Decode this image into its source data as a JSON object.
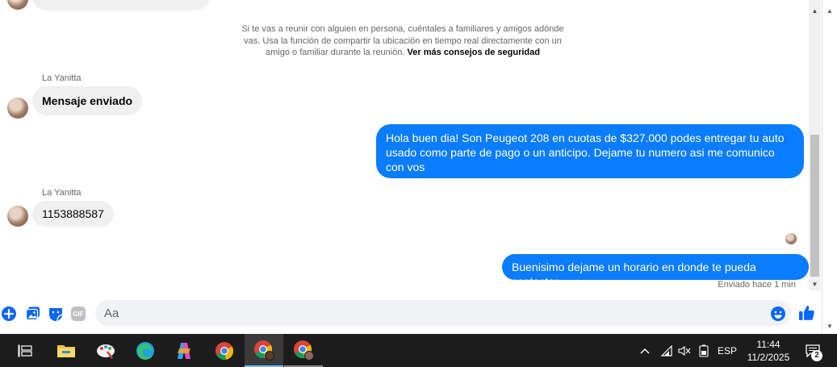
{
  "chat": {
    "safety_notice": {
      "text": "Si te vas a reunir con alguien en persona, cuéntales a familiares y amigos adónde vas. Usa la función de compartir la ubicación en tiempo real directamente con un amigo o familiar durante la reunión.",
      "link": "Ver más consejos de seguridad"
    },
    "messages": [
      {
        "sender": "La Yanitta",
        "text": "Mensaje enviado"
      },
      {
        "text": "Hola buen dia! Son Peugeot 208 en cuotas de $327.000 podes entregar tu auto usado como parte de pago o un anticipo. Dejame tu numero asi me comunico con vos"
      },
      {
        "sender": "La Yanitta",
        "text": "1153888587"
      },
      {
        "text": "Buenisimo dejame un horario en donde te pueda contactar"
      }
    ],
    "status": "Enviado hace 1 min"
  },
  "composer": {
    "placeholder": "Aa",
    "icons": [
      "plus-icon",
      "photo-icon",
      "sticker-icon",
      "gif-icon",
      "emoji-icon",
      "like-icon"
    ],
    "gif_label": "GIF"
  },
  "taskbar": {
    "apps": [
      "task-view",
      "file-explorer",
      "paint",
      "edge",
      "copilot",
      "chrome",
      "chrome-profile-1",
      "chrome-profile-2"
    ],
    "language": "ESP",
    "time": "11:44",
    "date": "11/2/2025",
    "notification_count": "2"
  },
  "colors": {
    "outgoing_bubble": "#0a7cff",
    "incoming_bubble": "#f0f0f0",
    "messenger_blue": "#0866ff",
    "taskbar": "#1c1c1c"
  }
}
